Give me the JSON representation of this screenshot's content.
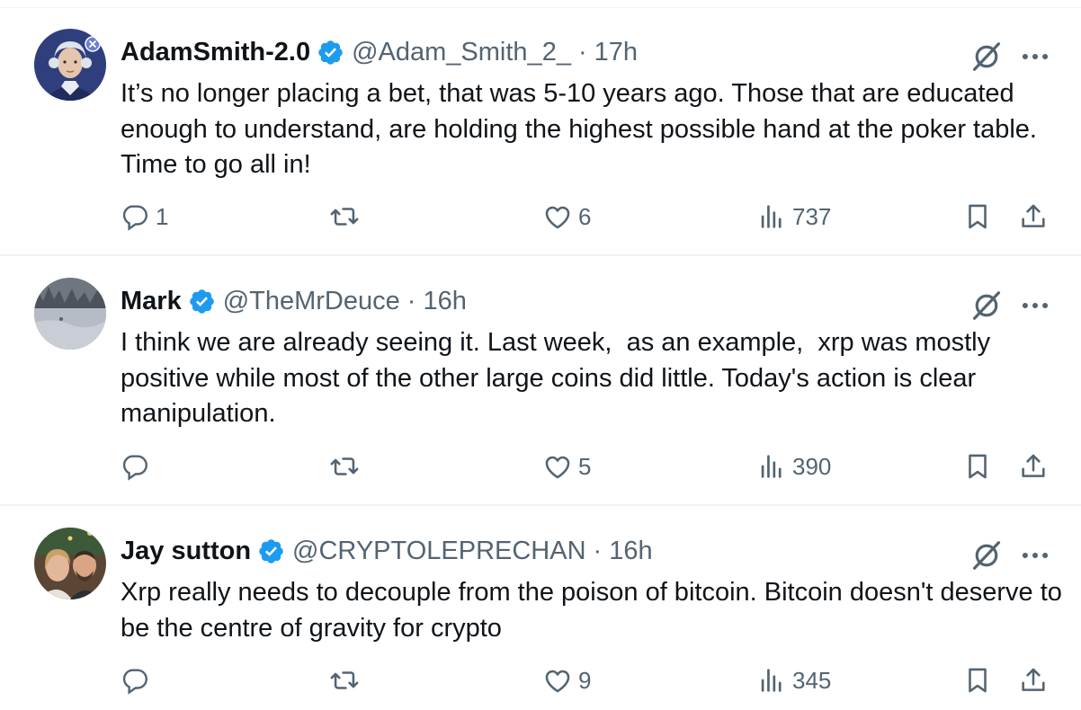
{
  "tweets": [
    {
      "name": "AdamSmith-2.0",
      "handle": "@Adam_Smith_2_",
      "separator": "·",
      "time": "17h",
      "text": "It’s no longer placing a bet, that was 5-10 years ago. Those that are educated enough to understand, are holding the highest possible hand at the poker table. Time to go all in!",
      "replies": "1",
      "retweets": "",
      "likes": "6",
      "views": "737"
    },
    {
      "name": "Mark",
      "handle": "@TheMrDeuce",
      "separator": "·",
      "time": "16h",
      "text": "I think we are already seeing it. Last week,  as an example,  xrp was mostly positive while most of the other large coins did little. Today's action is clear manipulation.",
      "replies": "",
      "retweets": "",
      "likes": "5",
      "views": "390"
    },
    {
      "name": "Jay sutton",
      "handle": "@CRYPTOLEPRECHAN",
      "separator": "·",
      "time": "16h",
      "text": "Xrp really needs to decouple from the poison of bitcoin. Bitcoin doesn't deserve to be the centre of gravity for crypto",
      "replies": "",
      "retweets": "",
      "likes": "9",
      "views": "345"
    }
  ],
  "colors": {
    "text": "#0f1419",
    "secondary": "#536471",
    "verified": "#1d9bf0",
    "divider": "#eff3f4"
  },
  "icons": {
    "verified": "verified-badge-icon",
    "grok": "grok-icon",
    "more": "more-dots-icon",
    "reply": "reply-icon",
    "retweet": "retweet-icon",
    "like": "heart-icon",
    "views": "views-chart-icon",
    "bookmark": "bookmark-icon",
    "share": "share-icon"
  }
}
